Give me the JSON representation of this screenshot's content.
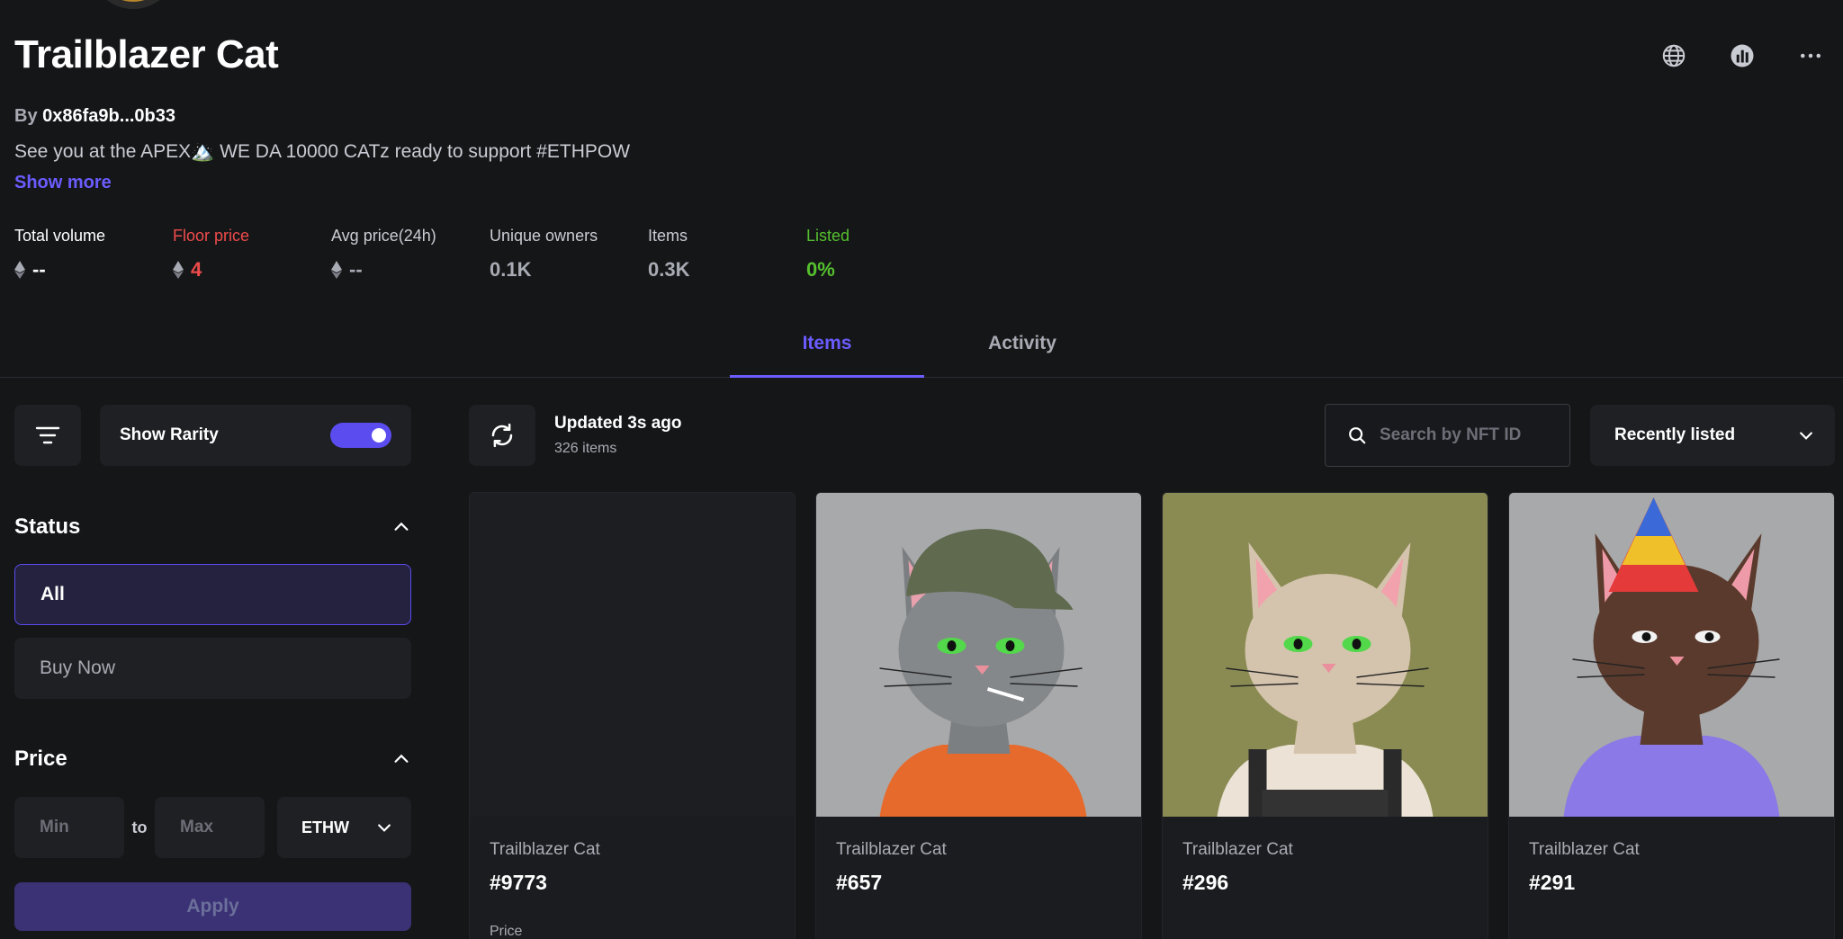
{
  "collection": {
    "title": "Trailblazer Cat",
    "by_label": "By",
    "creator": "0x86fa9b...0b33",
    "description": "See you at the APEX🏔️ WE DA 10000 CATz ready to support #ETHPOW",
    "show_more": "Show more"
  },
  "header_icons": [
    "globe-icon",
    "chart-icon",
    "more-icon"
  ],
  "stats": [
    {
      "label": "Total volume",
      "value": "--"
    },
    {
      "label": "Floor price",
      "value": "4"
    },
    {
      "label": "Avg price(24h)",
      "value": "--"
    },
    {
      "label": "Unique owners",
      "value": "0.1K"
    },
    {
      "label": "Items",
      "value": "0.3K"
    },
    {
      "label": "Listed",
      "value": "0%"
    }
  ],
  "tabs": [
    {
      "label": "Items",
      "active": true
    },
    {
      "label": "Activity",
      "active": false
    }
  ],
  "sidebar": {
    "show_rarity": "Show Rarity",
    "rarity_on": true,
    "status_title": "Status",
    "status_options": [
      {
        "label": "All",
        "active": true
      },
      {
        "label": "Buy Now",
        "active": false
      }
    ],
    "price_title": "Price",
    "min_placeholder": "Min",
    "to_label": "to",
    "max_placeholder": "Max",
    "currency": "ETHW",
    "apply_label": "Apply"
  },
  "toolbar": {
    "updated": "Updated 3s ago",
    "count": "326 items",
    "search_placeholder": "Search by NFT ID",
    "sort_label": "Recently listed"
  },
  "cards": [
    {
      "collection": "Trailblazer Cat",
      "id": "#9773",
      "price_label": "Price"
    },
    {
      "collection": "Trailblazer Cat",
      "id": "#657"
    },
    {
      "collection": "Trailblazer Cat",
      "id": "#296"
    },
    {
      "collection": "Trailblazer Cat",
      "id": "#291"
    }
  ],
  "colors": {
    "accent": "#6b5cff",
    "floor": "#ef4b4b",
    "listed": "#55c02e",
    "background": "#151618",
    "panel": "#1f2024"
  }
}
